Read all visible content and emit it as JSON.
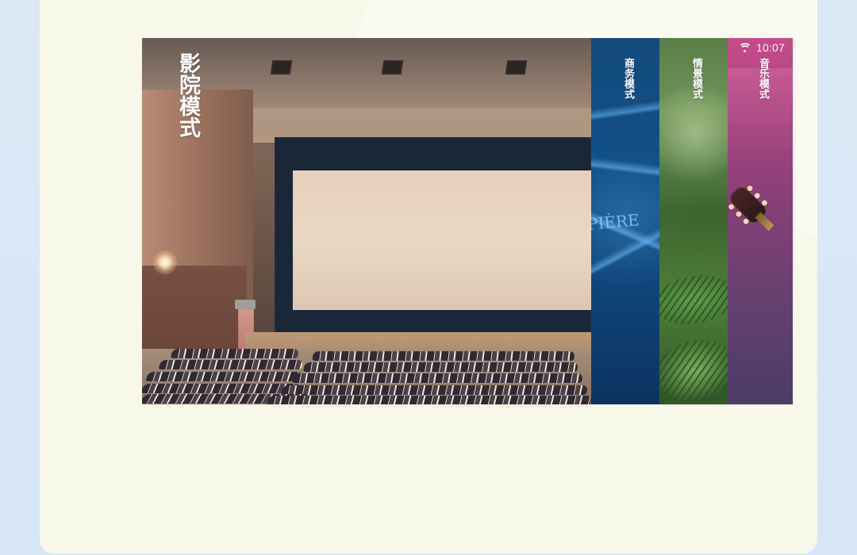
{
  "status_bar": {
    "time": "10:07",
    "wifi_icon": "wifi-icon"
  },
  "modes": {
    "cinema": "影院模式",
    "business": "商务模式",
    "scene": "情景模式",
    "music": "音乐模式"
  },
  "decorative": {
    "business_sketch_text": "PIÈRE"
  }
}
